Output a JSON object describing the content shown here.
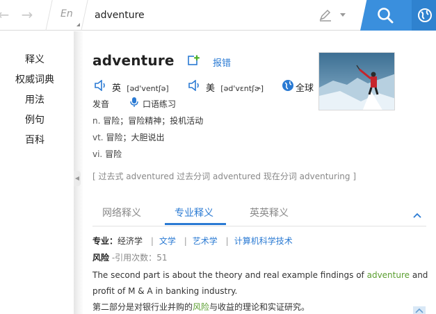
{
  "search": {
    "lang": "En",
    "query": "adventure"
  },
  "sidebar": {
    "items": [
      {
        "label": "释义"
      },
      {
        "label": "权威词典"
      },
      {
        "label": "用法"
      },
      {
        "label": "例句"
      },
      {
        "label": "百科"
      }
    ]
  },
  "entry": {
    "word": "adventure",
    "report_label": "报错",
    "pron_uk_label": "英",
    "pron_uk_phonetic": "[əd'ventʃə]",
    "pron_us_label": "美",
    "pron_us_phonetic": "[əd'vɛntʃɚ]",
    "pron_global_label": "全球",
    "fayin_label": "发音",
    "oral_practice_label": "口语练习",
    "definitions": [
      {
        "pos": "n.",
        "text": "冒险；冒险精神；投机活动"
      },
      {
        "pos": "vt.",
        "text": "冒险；大胆说出"
      },
      {
        "pos": "vi.",
        "text": "冒险"
      }
    ],
    "forms": "[ 过去式 adventured 过去分词 adventured 现在分词 adventuring ]"
  },
  "tabs": [
    {
      "label": "网络释义"
    },
    {
      "label": "专业释义"
    },
    {
      "label": "英英释义"
    }
  ],
  "professional": {
    "field_label": "专业：",
    "current_field": "经济学",
    "fields": [
      "文学",
      "艺术学",
      "计算机科学技术"
    ],
    "term": "风险",
    "cite_label": "-引用次数：",
    "cite_count": "51",
    "example_en_before": "The second part is about the theory and real example findings of ",
    "example_en_highlight": "adventure",
    "example_en_after": " and profit of M & A in banking industry.",
    "example_zh_before": "第二部分是对银行业并购的",
    "example_zh_highlight": "风险",
    "example_zh_after": "与收益的理论和实证研究。"
  },
  "colors": {
    "accent": "#2a7ad3",
    "search_button": "#3a8fdd",
    "highlight": "#5a9e2f"
  }
}
